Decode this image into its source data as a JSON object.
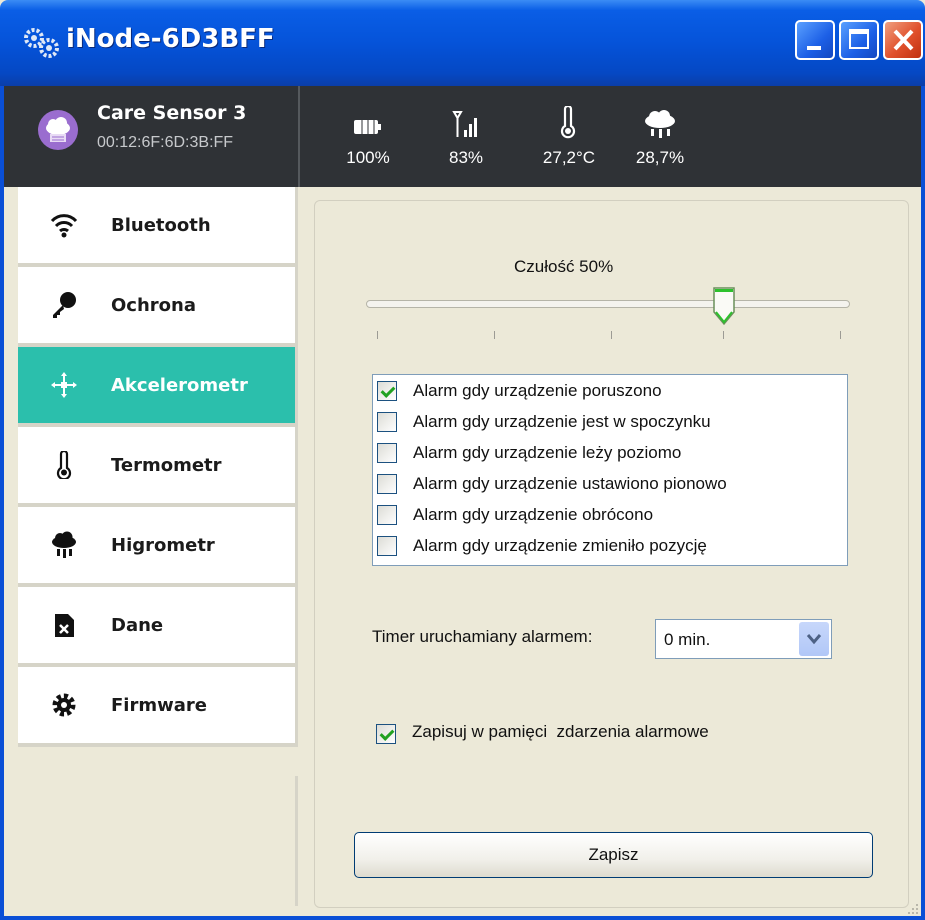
{
  "window": {
    "title": "iNode-6D3BFF",
    "title_icon": "gear-cluster-icon",
    "controls": [
      "minimize",
      "maximize",
      "close"
    ]
  },
  "header": {
    "sensor_name": "Care Sensor 3",
    "sensor_mac": "00:12:6F:6D:3B:FF",
    "avatar_icon": "cloud-sensor-icon",
    "stats": [
      {
        "icon": "battery-icon",
        "value": "100%"
      },
      {
        "icon": "signal-icon",
        "value": "83%"
      },
      {
        "icon": "thermometer-icon",
        "value": "27,2°C"
      },
      {
        "icon": "humidity-cloud-icon",
        "value": "28,7%"
      }
    ]
  },
  "sidebar": {
    "items": [
      {
        "label": "Bluetooth",
        "icon": "wifi-icon",
        "active": false
      },
      {
        "label": "Ochrona",
        "icon": "key-icon",
        "active": false
      },
      {
        "label": "Akcelerometr",
        "icon": "move-arrows-icon",
        "active": true
      },
      {
        "label": "Termometr",
        "icon": "thermometer-icon",
        "active": false
      },
      {
        "label": "Higrometr",
        "icon": "rain-cloud-icon",
        "active": false
      },
      {
        "label": "Dane",
        "icon": "file-x-icon",
        "active": false
      },
      {
        "label": "Firmware",
        "icon": "gear-icon",
        "active": false
      }
    ]
  },
  "panel": {
    "sensitivity_label": "Czułość 50%",
    "sensitivity_value": 0.5,
    "alarms": [
      {
        "label": "Alarm gdy urządzenie poruszono",
        "checked": true
      },
      {
        "label": "Alarm gdy urządzenie jest w spoczynku",
        "checked": false
      },
      {
        "label": "Alarm gdy urządzenie leży poziomo",
        "checked": false
      },
      {
        "label": "Alarm gdy urządzenie ustawiono pionowo",
        "checked": false
      },
      {
        "label": "Alarm gdy urządzenie obrócono",
        "checked": false
      },
      {
        "label": "Alarm gdy urządzenie zmieniło pozycję",
        "checked": false
      }
    ],
    "timer_label": "Timer uruchamiany alarmem:",
    "timer_value": "0 min.",
    "save_events_label": "Zapisuj w pamięci  zdarzenia alarmowe",
    "save_events_checked": true,
    "save_button": "Zapisz"
  },
  "colors": {
    "accent": "#2bbfac",
    "header_bg": "#2f3236",
    "titlebar": "#0553d9",
    "window_bg": "#ece9d8"
  }
}
